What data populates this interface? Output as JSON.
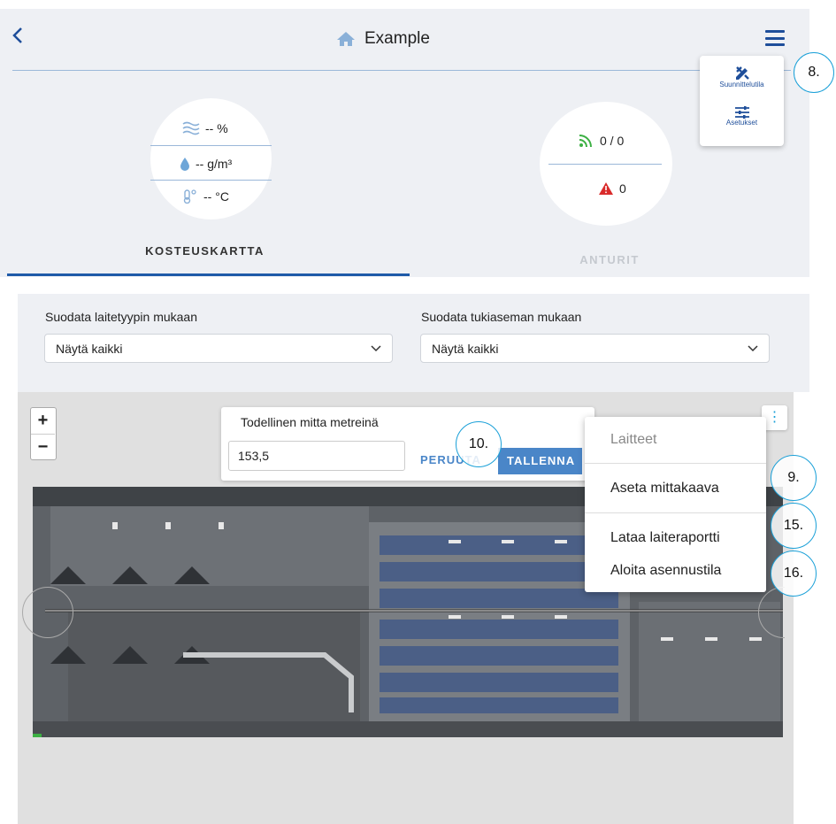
{
  "header": {
    "back_icon": "chevron-left-icon",
    "home_icon": "home-icon",
    "title": "Example",
    "menu_icon": "hamburger-icon"
  },
  "mode_menu": {
    "items": [
      {
        "icon": "pencil-ruler-icon",
        "label": "Suunnittelutila"
      },
      {
        "icon": "sliders-icon",
        "label": "Asetukset"
      }
    ]
  },
  "moisture": {
    "humidity": "-- %",
    "absolute": "-- g/m³",
    "temperature": "-- °C"
  },
  "sensors": {
    "signal": "0 / 0",
    "alerts": "0"
  },
  "tabs": [
    {
      "label": "KOSTEUSKARTTA",
      "active": true
    },
    {
      "label": "ANTURIT",
      "active": false
    }
  ],
  "filters": {
    "device_type": {
      "label": "Suodata laitetyypin mukaan",
      "value": "Näytä kaikki"
    },
    "base_station": {
      "label": "Suodata tukiaseman mukaan",
      "value": "Näytä kaikki"
    }
  },
  "map": {
    "zoom_in": "+",
    "zoom_out": "−",
    "scale_dialog": {
      "label": "Todellinen mitta metreinä",
      "value": "153,5",
      "cancel": "PERUUTA",
      "save": "TALLENNA"
    },
    "menu": {
      "header": "Laitteet",
      "items": [
        "Aseta mittakaava",
        "Lataa laiteraportti",
        "Aloita asennustila"
      ]
    }
  },
  "callouts": [
    "8.",
    "10.",
    "9.",
    "15.",
    "16."
  ],
  "colors": {
    "accent": "#1e4e9a",
    "callout": "#1aa0d8",
    "save_button": "#4a86c8",
    "signal": "#3cb043",
    "alert": "#d92b2b"
  }
}
